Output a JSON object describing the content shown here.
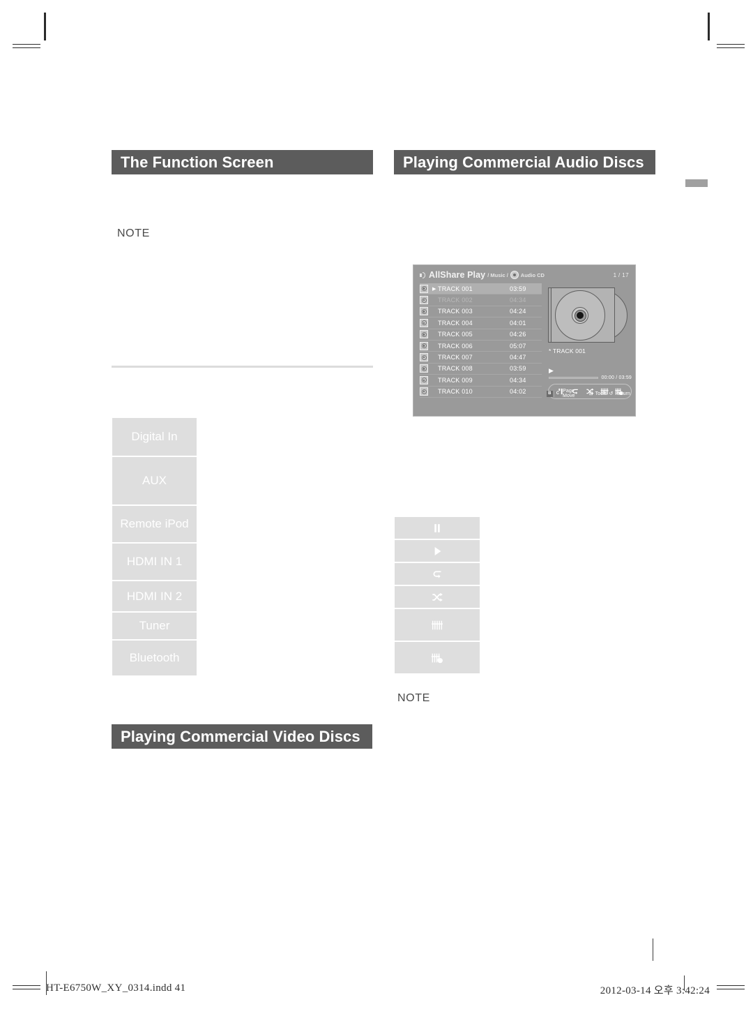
{
  "sections": {
    "function_screen_title": "The Function Screen",
    "audio_discs_title": "Playing Commercial Audio Discs",
    "video_discs_title": "Playing Commercial Video Discs",
    "note_left": "NOTE",
    "note_right": "NOTE"
  },
  "function_list": [
    {
      "label": "Digital In",
      "icon": ""
    },
    {
      "label": "AUX",
      "icon": ""
    },
    {
      "label": "Remote iPod",
      "icon": ""
    },
    {
      "label": "HDMI IN 1",
      "icon": ""
    },
    {
      "label": "HDMI IN 2",
      "icon": ""
    },
    {
      "label": "Tuner",
      "icon": ""
    },
    {
      "label": "Bluetooth",
      "icon": ""
    }
  ],
  "icon_list": [
    {
      "name": "pause-icon"
    },
    {
      "name": "play-icon"
    },
    {
      "name": "repeat-icon"
    },
    {
      "name": "shuffle-icon"
    },
    {
      "name": "sound-edit-icon"
    },
    {
      "name": "sound-edit-hand-icon"
    }
  ],
  "tv_screen": {
    "title": "AllShare Play",
    "breadcrumb_music": "/ Music /",
    "breadcrumb_source": "Audio CD",
    "page_count": "1 / 17",
    "tracks": [
      {
        "name": "TRACK 001",
        "time": "03:59",
        "selected": true,
        "dim": false
      },
      {
        "name": "TRACK 002",
        "time": "04:34",
        "selected": false,
        "dim": true
      },
      {
        "name": "TRACK 003",
        "time": "04:24",
        "selected": false,
        "dim": false
      },
      {
        "name": "TRACK 004",
        "time": "04:01",
        "selected": false,
        "dim": false
      },
      {
        "name": "TRACK 005",
        "time": "04:26",
        "selected": false,
        "dim": false
      },
      {
        "name": "TRACK 006",
        "time": "05:07",
        "selected": false,
        "dim": false
      },
      {
        "name": "TRACK 007",
        "time": "04:47",
        "selected": false,
        "dim": false
      },
      {
        "name": "TRACK 008",
        "time": "03:59",
        "selected": false,
        "dim": false
      },
      {
        "name": "TRACK 009",
        "time": "04:34",
        "selected": false,
        "dim": false
      },
      {
        "name": "TRACK 010",
        "time": "04:02",
        "selected": false,
        "dim": false
      }
    ],
    "now_playing": "* TRACK 001",
    "progress_time": "00:00 / 03:59",
    "transport_buttons": [
      {
        "name": "pause-icon"
      },
      {
        "name": "repeat-icon"
      },
      {
        "name": "shuffle-icon"
      },
      {
        "name": "sound-edit-icon"
      },
      {
        "name": "sound-edit-hand-icon"
      }
    ],
    "footer_hints": {
      "key_b": "B",
      "key_c": "C",
      "page_move": "Page Move",
      "tools": "Tools",
      "return": "Return"
    }
  },
  "page_footer": {
    "file": "HT-E6750W_XY_0314.indd   41",
    "date": "2012-03-14   오후 3:42:24"
  },
  "colors": {
    "heading_bar": "#5c5c5c",
    "button_fill": "#dedede",
    "screen_bg": "#9a9a9a"
  }
}
